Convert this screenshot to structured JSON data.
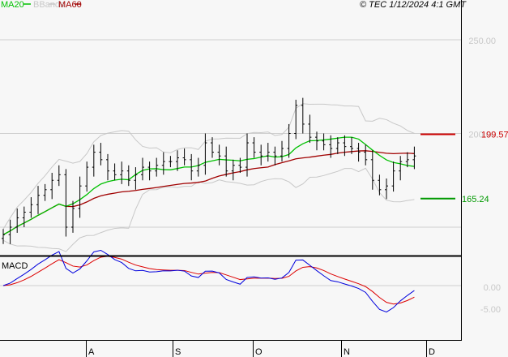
{
  "header": {
    "legend": [
      {
        "label": "MA20",
        "color": "#00c000"
      },
      {
        "label": "BBands",
        "color": "#c8c8c8"
      },
      {
        "label": "MA60",
        "color": "#a00000"
      }
    ],
    "copyright": "© TEC 1/12/2024 4:1 GMT"
  },
  "chart_data": {
    "type": "ohlc",
    "price_axis": {
      "ticks": [
        {
          "value": 250,
          "label": "250.00"
        },
        {
          "value": 200,
          "label": "200.00"
        },
        {
          "value": 150,
          "label": ""
        }
      ],
      "ylim": [
        128,
        278
      ]
    },
    "months": [
      "A",
      "S",
      "O",
      "N",
      "D"
    ],
    "closes": [
      146,
      150,
      155,
      158,
      162,
      167,
      170,
      175,
      178,
      150,
      160,
      172,
      182,
      190,
      186,
      180,
      178,
      180,
      175,
      178,
      182,
      180,
      183,
      185,
      185,
      187,
      186,
      180,
      183,
      195,
      190,
      188,
      180,
      183,
      182,
      195,
      190,
      188,
      190,
      188,
      192,
      200,
      215,
      205,
      198,
      196,
      194,
      192,
      195,
      193,
      192,
      190,
      186,
      175,
      170,
      172,
      180,
      185,
      186,
      188
    ],
    "levels": [
      {
        "value": 199.57,
        "label": "199.57",
        "color": "#cc0000"
      },
      {
        "value": 165.24,
        "label": "165.24",
        "color": "#009900"
      }
    ],
    "macd": {
      "title": "MACD",
      "ticks": [
        {
          "value": 0,
          "label": "0.00"
        },
        {
          "value": -5,
          "label": "-5.00"
        }
      ],
      "line_color": "#0000dd",
      "signal_color": "#dd0000"
    }
  }
}
